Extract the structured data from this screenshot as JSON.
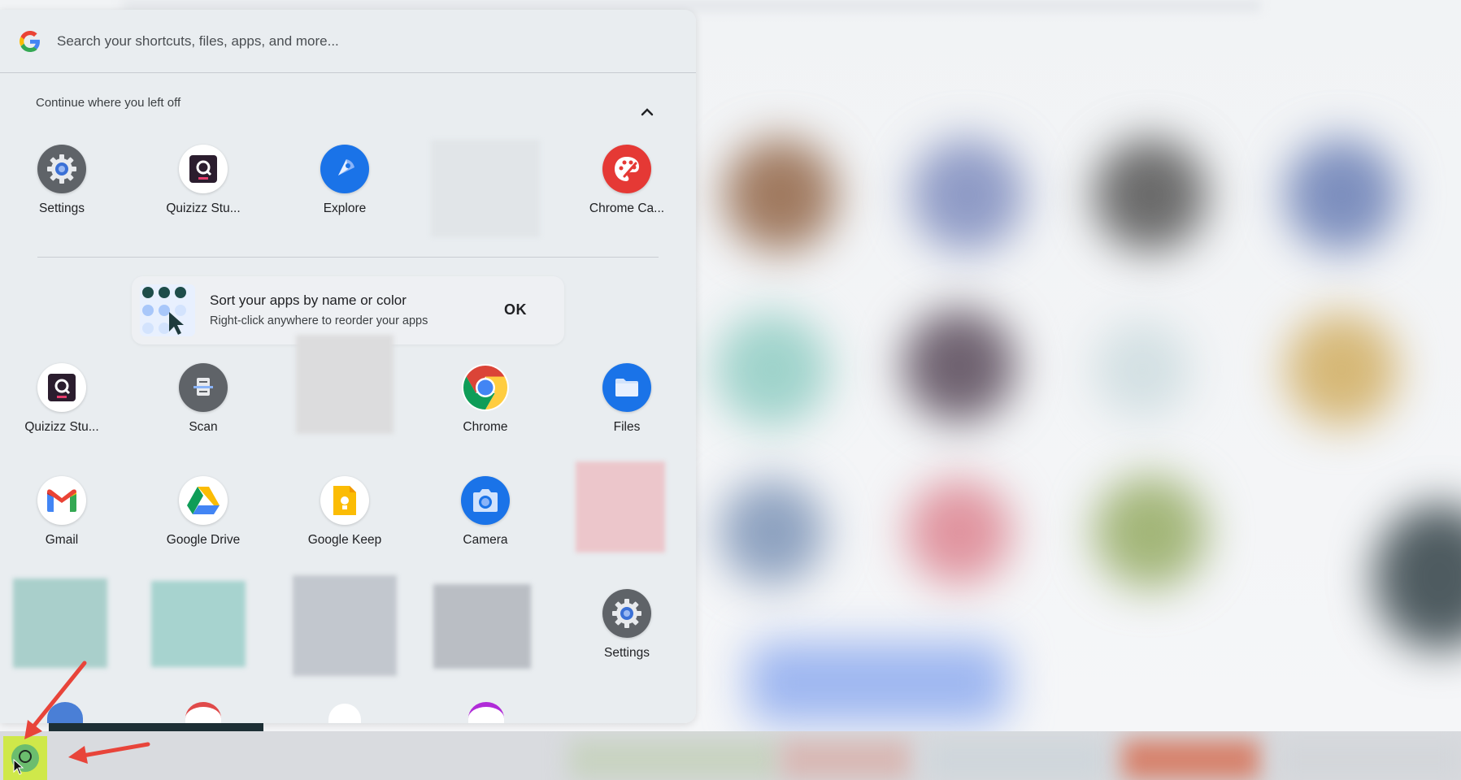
{
  "search": {
    "placeholder": "Search your shortcuts, files, apps, and more..."
  },
  "continue_section": {
    "title": "Continue where you left off",
    "items": [
      {
        "label": "Settings",
        "icon": "settings-icon"
      },
      {
        "label": "Quizizz Stu...",
        "icon": "quizizz-icon"
      },
      {
        "label": "Explore",
        "icon": "explore-icon"
      },
      {
        "label": "Chrome Ca...",
        "icon": "chrome-canvas-icon"
      }
    ]
  },
  "nudge": {
    "title": "Sort your apps by name or color",
    "subtitle": "Right-click anywhere to reorder your apps",
    "ok_label": "OK"
  },
  "apps": [
    {
      "label": "Quizizz Stu...",
      "icon": "quizizz-icon"
    },
    {
      "label": "Scan",
      "icon": "scan-icon"
    },
    {
      "label": "Chrome",
      "icon": "chrome-icon"
    },
    {
      "label": "Files",
      "icon": "files-icon"
    },
    {
      "label": "Gmail",
      "icon": "gmail-icon"
    },
    {
      "label": "Google Drive",
      "icon": "google-drive-icon"
    },
    {
      "label": "Google Keep",
      "icon": "google-keep-icon"
    },
    {
      "label": "Camera",
      "icon": "camera-icon"
    },
    {
      "label": "Settings",
      "icon": "settings-icon"
    }
  ],
  "colors": {
    "launcher_bg": "#e8ecf0",
    "launcher_button": "#cfe84a",
    "annotation_arrow": "#e8443a"
  }
}
